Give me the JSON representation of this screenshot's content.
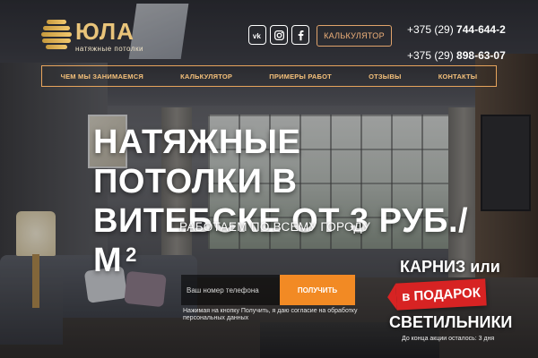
{
  "header": {
    "logo": {
      "name": "ЮЛА",
      "tagline": "натяжные потолки"
    },
    "socials": [
      {
        "name": "vk-icon",
        "glyph": "vk"
      },
      {
        "name": "instagram-icon",
        "glyph": "ig"
      },
      {
        "name": "facebook-icon",
        "glyph": "f"
      }
    ],
    "calc_button": "КАЛЬКУЛЯТОР",
    "phones": [
      {
        "prefix": "+375 (29) ",
        "number": "744-644-2"
      },
      {
        "prefix": "+375 (29) ",
        "number": "898-63-07"
      }
    ]
  },
  "nav": {
    "items": [
      {
        "label": "ЧЕМ МЫ ЗАНИМАЕМСЯ"
      },
      {
        "label": "КАЛЬКУЛЯТОР"
      },
      {
        "label": "ПРИМЕРЫ РАБОТ"
      },
      {
        "label": "ОТЗЫВЫ"
      },
      {
        "label": "КОНТАКТЫ"
      }
    ]
  },
  "hero": {
    "title_line1": "НАТЯЖНЫЕ ПОТОЛКИ В",
    "title_line2": "ВИТЕБСКЕ ОТ 3 РУБ./М",
    "title_sup": "2",
    "subtitle": "РАБОТАЕМ ПО ВСЕМУ ГОРОДУ"
  },
  "form": {
    "phone_placeholder": "Ваш номер телефона",
    "submit_label": "ПОЛУЧИТЬ",
    "consent": "Нажимая на кнопку Получить, я даю согласие на обработку персональных данных"
  },
  "promo": {
    "line1": "КАРНИЗ или",
    "badge": "в ПОДАРОК",
    "line2": "СВЕТИЛЬНИКИ",
    "countdown": "До конца акции осталось: 3 дня"
  },
  "colors": {
    "accent_orange": "#f28a24",
    "nav_border": "#e7a45c",
    "logo_gold": "#e9c47a",
    "badge_red": "#d72323"
  }
}
